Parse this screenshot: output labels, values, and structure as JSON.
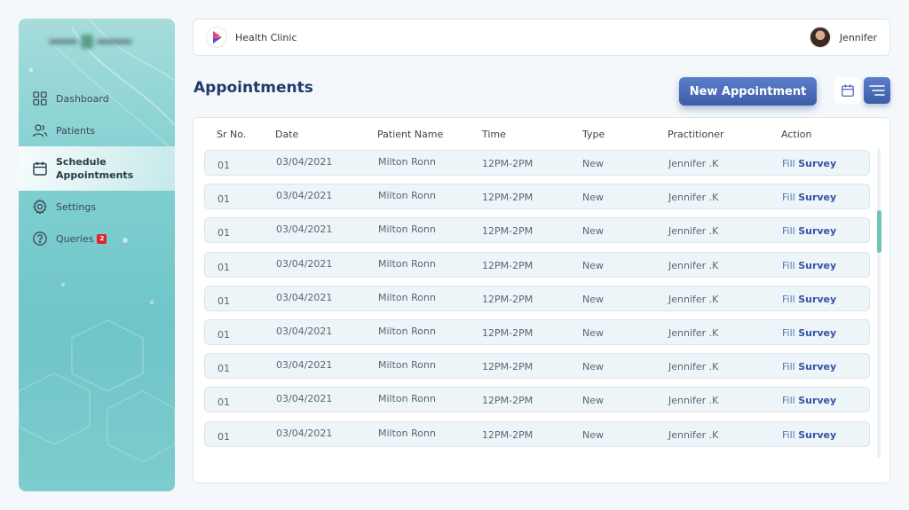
{
  "app": {
    "name": "Health Clinic",
    "user_name": "Jennifer"
  },
  "sidebar": {
    "items": [
      {
        "label": "Dashboard",
        "icon": "grid-icon"
      },
      {
        "label": "Patients",
        "icon": "users-icon"
      },
      {
        "label": "Schedule Appointments",
        "icon": "calendar-icon",
        "active": true
      },
      {
        "label": "Settings",
        "icon": "gear-icon"
      },
      {
        "label": "Queries",
        "icon": "question-icon",
        "badge": "2"
      }
    ]
  },
  "main": {
    "title": "Appointments",
    "new_button": "New Appointment",
    "view_icons": [
      "calendar-icon",
      "list-icon"
    ]
  },
  "table": {
    "headers": [
      "Sr No.",
      "Date",
      "Patient Name",
      "Time",
      "Type",
      "Practitioner",
      "Action"
    ],
    "rows": [
      {
        "sr": "01",
        "date": "03/04/2021",
        "patient": "Milton Ronn",
        "time": "12PM-2PM",
        "type": "New",
        "practitioner": "Jennifer .K",
        "action_a": "Fill",
        "action_b": "Survey"
      },
      {
        "sr": "01",
        "date": "03/04/2021",
        "patient": "Milton Ronn",
        "time": "12PM-2PM",
        "type": "New",
        "practitioner": "Jennifer .K",
        "action_a": "Fill",
        "action_b": "Survey"
      },
      {
        "sr": "01",
        "date": "03/04/2021",
        "patient": "Milton Ronn",
        "time": "12PM-2PM",
        "type": "New",
        "practitioner": "Jennifer .K",
        "action_a": "Fill",
        "action_b": "Survey"
      },
      {
        "sr": "01",
        "date": "03/04/2021",
        "patient": "Milton Ronn",
        "time": "12PM-2PM",
        "type": "New",
        "practitioner": "Jennifer .K",
        "action_a": "Fill",
        "action_b": "Survey"
      },
      {
        "sr": "01",
        "date": "03/04/2021",
        "patient": "Milton Ronn",
        "time": "12PM-2PM",
        "type": "New",
        "practitioner": "Jennifer .K",
        "action_a": "Fill",
        "action_b": "Survey"
      },
      {
        "sr": "01",
        "date": "03/04/2021",
        "patient": "Milton Ronn",
        "time": "12PM-2PM",
        "type": "New",
        "practitioner": "Jennifer .K",
        "action_a": "Fill",
        "action_b": "Survey"
      },
      {
        "sr": "01",
        "date": "03/04/2021",
        "patient": "Milton Ronn",
        "time": "12PM-2PM",
        "type": "New",
        "practitioner": "Jennifer .K",
        "action_a": "Fill",
        "action_b": "Survey"
      },
      {
        "sr": "01",
        "date": "03/04/2021",
        "patient": "Milton Ronn",
        "time": "12PM-2PM",
        "type": "New",
        "practitioner": "Jennifer .K",
        "action_a": "Fill",
        "action_b": "Survey"
      },
      {
        "sr": "01",
        "date": "03/04/2021",
        "patient": "Milton Ronn",
        "time": "12PM-2PM",
        "type": "New",
        "practitioner": "Jennifer .K",
        "action_a": "Fill",
        "action_b": "Survey"
      }
    ]
  },
  "colors": {
    "accent": "#3c5ea8",
    "title": "#1f3b6a",
    "sidebar": "#7fcfd0",
    "badge": "#e0262f",
    "scroll_thumb": "#6fc5b8"
  }
}
